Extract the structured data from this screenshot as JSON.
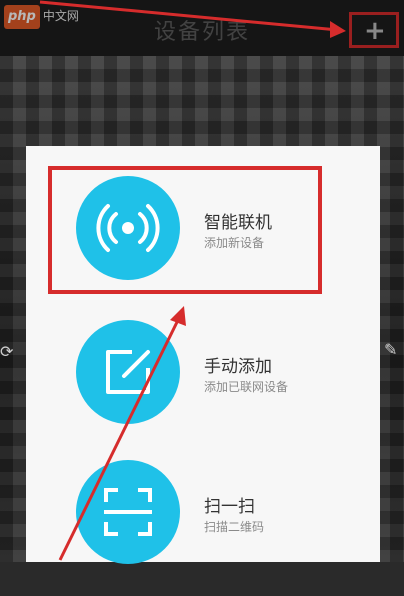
{
  "header": {
    "title": "设备列表",
    "add_symbol": "+"
  },
  "watermark": {
    "brand": "php",
    "text": "中文网"
  },
  "menu": {
    "items": [
      {
        "title": "智能联机",
        "subtitle": "添加新设备",
        "icon": "wifi-signal-icon"
      },
      {
        "title": "手动添加",
        "subtitle": "添加已联网设备",
        "icon": "edit-icon"
      },
      {
        "title": "扫一扫",
        "subtitle": "扫描二维码",
        "icon": "scan-icon"
      }
    ]
  },
  "colors": {
    "accent": "#1fc1e8",
    "highlight": "#d62c2c"
  }
}
